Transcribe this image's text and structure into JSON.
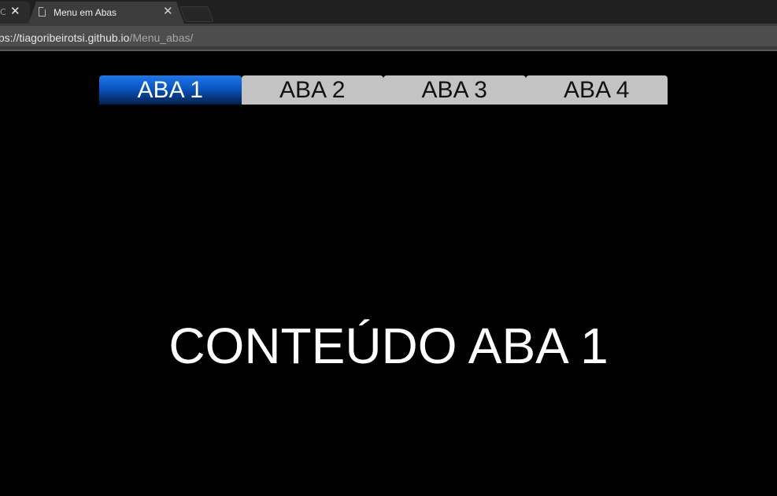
{
  "browser": {
    "tabs": [
      {
        "title": "Cc",
        "active": false
      },
      {
        "title": "Menu em Abas",
        "active": true
      }
    ],
    "close_glyph": "✕",
    "url": {
      "host": "tps://tiagoribeirotsi.github.io",
      "path": "/Menu_abas/"
    }
  },
  "page": {
    "tabs": [
      {
        "label": "ABA 1",
        "active": true
      },
      {
        "label": "ABA 2",
        "active": false
      },
      {
        "label": "ABA 3",
        "active": false
      },
      {
        "label": "ABA 4",
        "active": false
      }
    ],
    "content": "CONTEÚDO ABA 1"
  },
  "colors": {
    "active_tab_top": "#1f77e8",
    "active_tab_bottom": "#02204c",
    "inactive_tab": "#c3c3c3",
    "page_background": "#000000"
  }
}
